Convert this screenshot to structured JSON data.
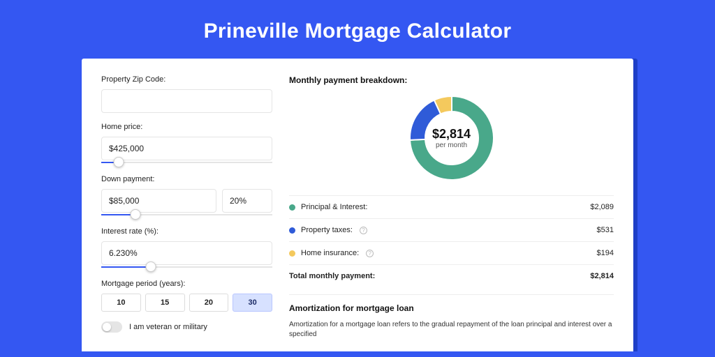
{
  "title": "Prineville Mortgage Calculator",
  "colors": {
    "green": "#49a88a",
    "blue": "#2f5bd8",
    "yellow": "#f4c95d"
  },
  "form": {
    "zip": {
      "label": "Property Zip Code:",
      "value": ""
    },
    "home_price": {
      "label": "Home price:",
      "value": "$425,000",
      "slider_pct": 10
    },
    "down_payment": {
      "label": "Down payment:",
      "value": "$85,000",
      "pct": "20%",
      "slider_pct": 20
    },
    "interest": {
      "label": "Interest rate (%):",
      "value": "6.230%",
      "slider_pct": 29
    },
    "period": {
      "label": "Mortgage period (years):",
      "options": [
        "10",
        "15",
        "20",
        "30"
      ],
      "selected": "30"
    },
    "veteran": {
      "label": "I am veteran or military",
      "on": false
    }
  },
  "breakdown": {
    "heading": "Monthly payment breakdown:",
    "center_value": "$2,814",
    "center_sub": "per month",
    "items": [
      {
        "label": "Principal & Interest:",
        "value": "$2,089",
        "color": "green",
        "info": false
      },
      {
        "label": "Property taxes:",
        "value": "$531",
        "color": "blue",
        "info": true
      },
      {
        "label": "Home insurance:",
        "value": "$194",
        "color": "yellow",
        "info": true
      }
    ],
    "total": {
      "label": "Total monthly payment:",
      "value": "$2,814"
    }
  },
  "chart_data": {
    "type": "pie",
    "title": "Monthly payment breakdown",
    "series": [
      {
        "name": "Principal & Interest",
        "value": 2089,
        "color": "#49a88a"
      },
      {
        "name": "Property taxes",
        "value": 531,
        "color": "#2f5bd8"
      },
      {
        "name": "Home insurance",
        "value": 194,
        "color": "#f4c95d"
      }
    ],
    "total": 2814,
    "center_label": "$2,814 per month"
  },
  "amortization": {
    "heading": "Amortization for mortgage loan",
    "body": "Amortization for a mortgage loan refers to the gradual repayment of the loan principal and interest over a specified"
  }
}
